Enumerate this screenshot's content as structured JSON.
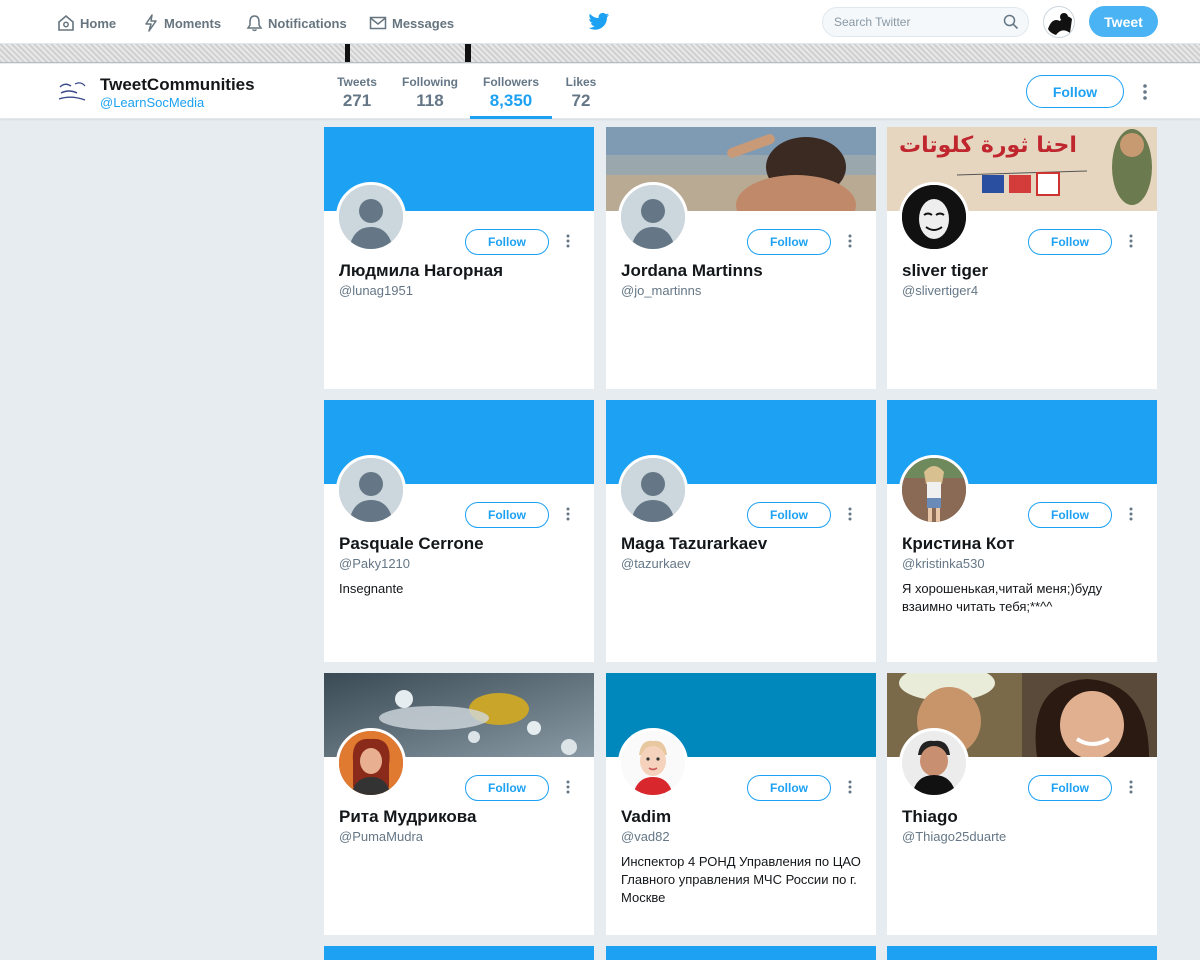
{
  "nav": {
    "home": "Home",
    "moments": "Moments",
    "notifications": "Notifications",
    "messages": "Messages",
    "search_placeholder": "Search Twitter",
    "tweet_button": "Tweet"
  },
  "profile": {
    "name": "TweetCommunities",
    "handle": "@LearnSocMedia",
    "follow_label": "Follow",
    "stats": [
      {
        "label": "Tweets",
        "value": "271"
      },
      {
        "label": "Following",
        "value": "118"
      },
      {
        "label": "Followers",
        "value": "8,350"
      },
      {
        "label": "Likes",
        "value": "72"
      }
    ]
  },
  "colors": {
    "accent": "#1da1f2",
    "page_bg": "#e6ecf0"
  },
  "cards": [
    {
      "name": "Людмила Нагорная",
      "handle": "@lunag1951",
      "bio": "",
      "follow": "Follow"
    },
    {
      "name": "Jordana Martinns",
      "handle": "@jo_martinns",
      "bio": "",
      "follow": "Follow"
    },
    {
      "name": "sliver tiger",
      "handle": "@slivertiger4",
      "bio": "",
      "follow": "Follow",
      "banner_text": "احنا ثورة كلوتات"
    },
    {
      "name": "Pasquale Cerrone",
      "handle": "@Paky1210",
      "bio": "Insegnante",
      "follow": "Follow"
    },
    {
      "name": "Maga Tazurarkaev",
      "handle": "@tazurkaev",
      "bio": "",
      "follow": "Follow"
    },
    {
      "name": "Кристина Кот",
      "handle": "@kristinka530",
      "bio": "Я хорошенькая,читай меня;)буду взаимно читать тебя;**^^",
      "follow": "Follow"
    },
    {
      "name": "Рита Мудрикова",
      "handle": "@PumaMudra",
      "bio": "",
      "follow": "Follow"
    },
    {
      "name": "Vadim",
      "handle": "@vad82",
      "bio": "Инспектор 4 РОНД Управления по ЦАО Главного управления МЧС России по г. Москве",
      "follow": "Follow"
    },
    {
      "name": "Thiago",
      "handle": "@Thiago25duarte",
      "bio": "",
      "follow": "Follow"
    }
  ]
}
